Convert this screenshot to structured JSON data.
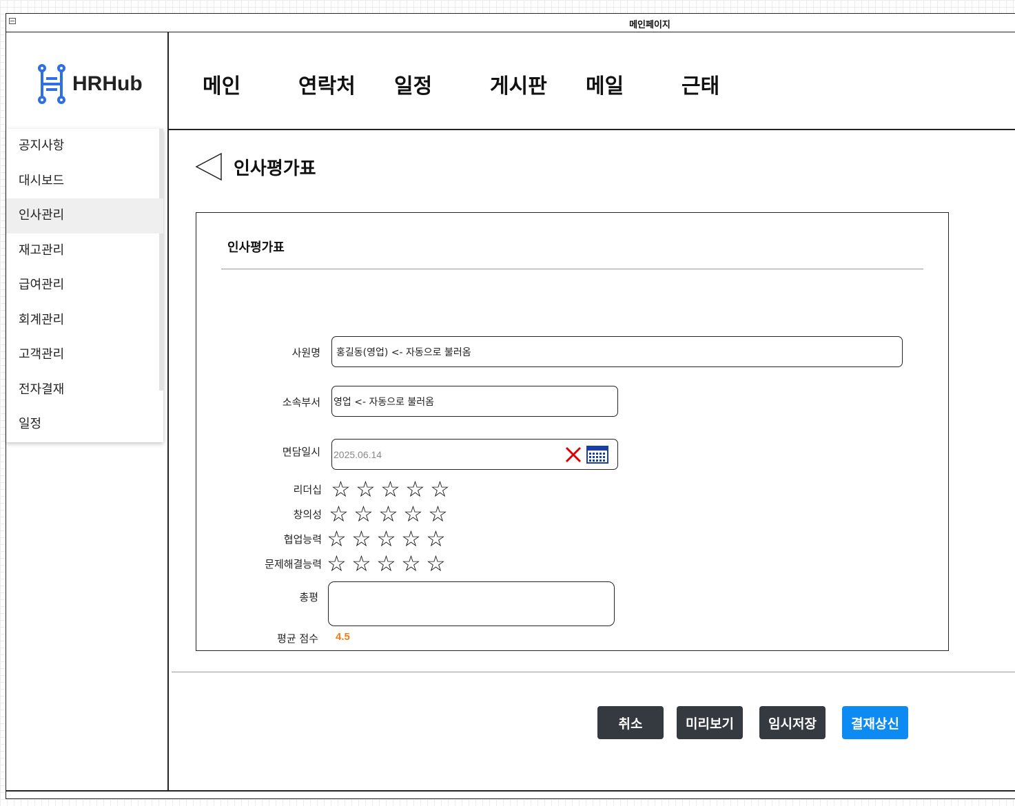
{
  "window": {
    "title": "메인페이지"
  },
  "logo": {
    "text": "HRHub"
  },
  "topnav": {
    "items": [
      "메인",
      "연락처",
      "일정",
      "게시판",
      "메일",
      "근태"
    ]
  },
  "sidemenu": {
    "items": [
      "공지사항",
      "대시보드",
      "인사관리",
      "재고관리",
      "급여관리",
      "회계관리",
      "고객관리",
      "전자결재",
      "일정"
    ],
    "active": "인사관리"
  },
  "page": {
    "title": "인사평가표"
  },
  "form": {
    "title": "인사평가표",
    "employee_label": "사원명",
    "employee_value": "홍길동(영업)   <- 자동으로 불러옴",
    "department_label": "소속부서",
    "department_value": "영업  <- 자동으로 불러옴",
    "interview_label": "면담일시",
    "interview_value": "2025.06.14",
    "ratings": [
      {
        "label": "리더십",
        "stars": 5,
        "filled": 0
      },
      {
        "label": "창의성",
        "stars": 5,
        "filled": 0
      },
      {
        "label": "협업능력",
        "stars": 5,
        "filled": 0
      },
      {
        "label": "문제해결능력",
        "stars": 5,
        "filled": 0
      }
    ],
    "star_glyph": "☆",
    "review_label": "총평",
    "review_value": "",
    "average_label": "평균 점수",
    "average_value": "4.5",
    "accent_color": "#f07e12"
  },
  "buttons": {
    "cancel": "취소",
    "preview": "미리보기",
    "save_draft": "임시저장",
    "submit": "결재상신"
  },
  "colors": {
    "primary": "#0d8bf2",
    "dark": "#343a40",
    "logo": "#2f6fe6",
    "clear": "#e00000",
    "calendar": "#1a3ea8"
  }
}
